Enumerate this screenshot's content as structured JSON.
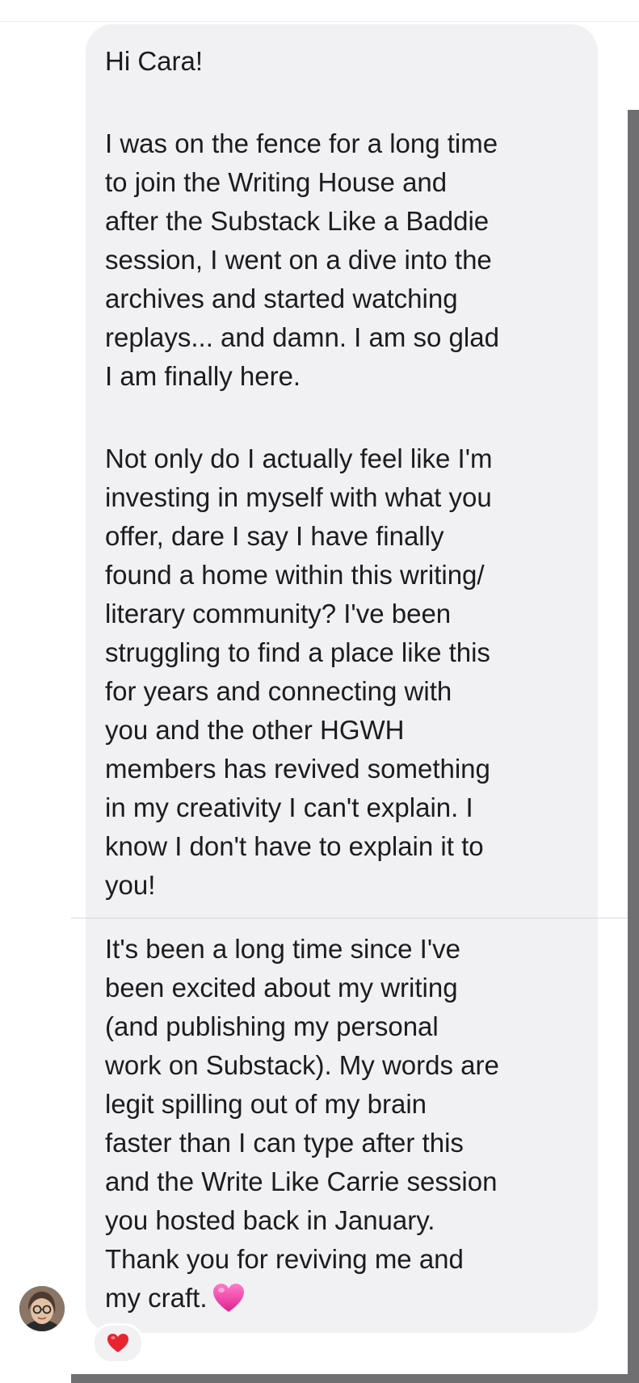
{
  "conversation": {
    "message": {
      "greeting": "Hi Cara!",
      "paragraph_1": "I was on the fence for a long time\nto join the Writing House and\nafter the Substack Like a Baddie\nsession, I went on a dive into the\narchives and started watching\nreplays... and damn. I am so glad\nI am finally here.",
      "paragraph_2": "Not only do I actually feel like I'm\ninvesting in myself with what you\noffer, dare I say I have finally\nfound a home within this writing/\nliterary community? I've been\nstruggling to find a place like this\nfor years and connecting with\nyou and the other HGWH\nmembers has revived something\nin my creativity I can't explain. I\nknow I don't have to explain it to\nyou!",
      "paragraph_3": "It's been a long time since I've\nbeen excited about my writing\n(and publishing my personal\nwork on Substack). My words are\nlegit spilling out of my brain\nfaster than I can type after this\nand the Write Like Carrie session\nyou hosted back in January.\nThank you for reviving me and\nmy craft.",
      "trailing_emoji": "pink-heart-icon"
    },
    "reaction": "red-heart-icon",
    "sender_avatar": "avatar"
  },
  "colors": {
    "bubble": "#f1f1f3",
    "text": "#1c1c1e",
    "pink_heart": "#f03aa7",
    "red_heart": "#e8242f",
    "scrollbar": "#6f6f71"
  }
}
